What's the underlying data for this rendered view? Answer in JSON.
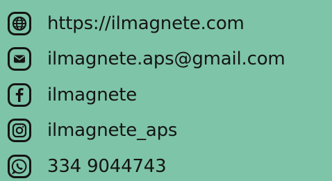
{
  "contacts": [
    {
      "type": "website",
      "icon": "globe-icon",
      "text": "https://ilmagnete.com"
    },
    {
      "type": "email",
      "icon": "mail-icon",
      "text": "ilmagnete.aps@gmail.com"
    },
    {
      "type": "facebook",
      "icon": "facebook-icon",
      "text": "ilmagnete"
    },
    {
      "type": "instagram",
      "icon": "instagram-icon",
      "text": "ilmagnete_aps"
    },
    {
      "type": "whatsapp",
      "icon": "whatsapp-icon",
      "text": "334 9044743"
    }
  ],
  "colors": {
    "background": "#7ec4a8",
    "foreground": "#141414"
  }
}
